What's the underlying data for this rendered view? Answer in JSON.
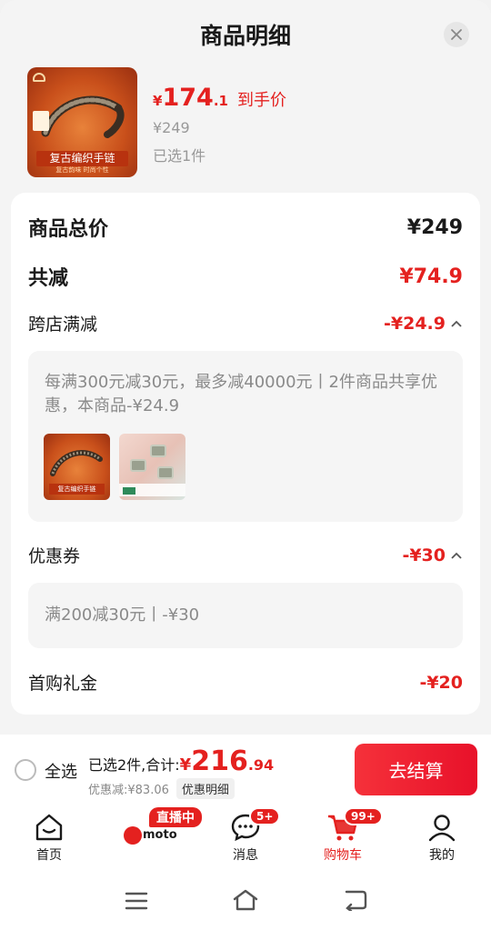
{
  "header": {
    "title": "商品明细",
    "close_icon": "close-icon"
  },
  "product": {
    "image_caption": "复古编织手链",
    "image_subcaption": "复古韵味 时尚个性",
    "price_symbol": "¥",
    "price_int": "174",
    "price_dec": ".1",
    "price_tail": "到手价",
    "original_price": "¥249",
    "selected_count": "已选1件"
  },
  "breakdown": {
    "total_label": "商品总价",
    "total_value": "¥249",
    "reduce_label": "共减",
    "reduce_value": "¥74.9",
    "cross_store_label": "跨店满减",
    "cross_store_value": "-¥24.9",
    "cross_store_desc": "每满300元减30元，最多减40000元丨2件商品共享优惠，本商品-¥24.9",
    "thumb1_caption": "复古编织手链",
    "coupon_label": "优惠券",
    "coupon_value": "-¥30",
    "coupon_desc": "满200减30元丨-¥30",
    "first_gift_label": "首购礼金",
    "first_gift_value": "-¥20"
  },
  "bottom_bar": {
    "select_all": "全选",
    "summary_prefix": "已选2件,合计:",
    "sum_symbol": "¥",
    "sum_int": "216",
    "sum_dec": ".94",
    "discount_text": "优惠减:¥83.06",
    "detail_button": "优惠明细",
    "checkout_button": "去结算"
  },
  "tabbar": {
    "home": "首页",
    "live_badge": "直播中",
    "live_brand": "moto",
    "messages": "消息",
    "messages_badge": "5+",
    "cart": "购物车",
    "cart_badge": "99+",
    "mine": "我的"
  },
  "colors": {
    "accent": "#e4211f",
    "background": "#f4f4f4"
  }
}
